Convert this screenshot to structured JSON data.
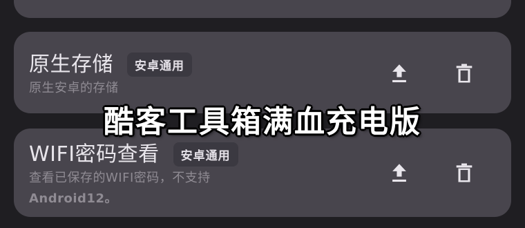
{
  "overlay": {
    "title": "酷客工具箱满血充电版"
  },
  "cards": [
    {
      "title": "原生存储",
      "badge": "安卓通用",
      "description": "原生安卓的存储",
      "actions": [
        "upload-icon",
        "trash-icon"
      ]
    },
    {
      "title": "WIFI密码查看",
      "badge": "安卓通用",
      "description_line1": "查看已保存的WIFI密码，不支持",
      "description_line2": "Android12。",
      "actions": [
        "upload-icon",
        "trash-icon"
      ]
    }
  ],
  "colors": {
    "background": "#1f1e22",
    "card": "#48454d",
    "badge": "#3b3941",
    "title": "#e9e6ec",
    "description": "#8f8b93",
    "icon": "#e9e6ec"
  }
}
